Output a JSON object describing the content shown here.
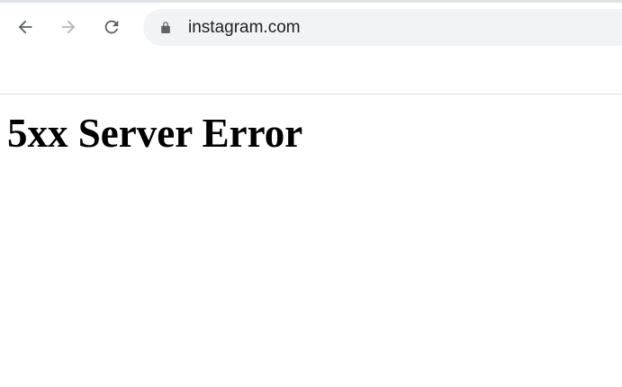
{
  "browser": {
    "nav": {
      "back_icon": "arrow-left-icon",
      "forward_icon": "arrow-right-icon",
      "reload_icon": "reload-icon"
    },
    "address_bar": {
      "security_icon": "lock-icon",
      "url": "instagram.com"
    }
  },
  "page": {
    "heading": "5xx Server Error"
  },
  "colors": {
    "omnibox_bg": "#f1f3f4",
    "icon_active": "#5f6368",
    "icon_disabled": "#b4b6b9",
    "text": "#202124"
  }
}
